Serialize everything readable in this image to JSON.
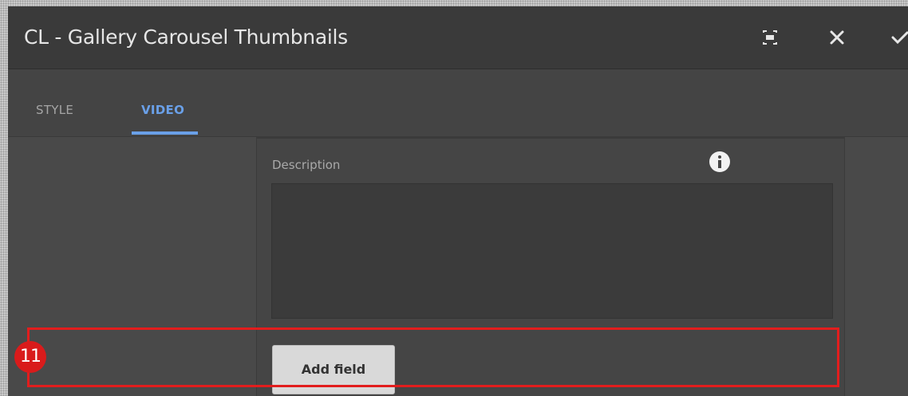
{
  "dialog": {
    "title": "CL - Gallery Carousel Thumbnails",
    "icons": {
      "fullscreen": "fullscreen-icon",
      "close": "close-icon",
      "confirm": "check-icon"
    }
  },
  "tabs": [
    {
      "label": "STYLE",
      "active": false
    },
    {
      "label": "VIDEO",
      "active": true
    }
  ],
  "form": {
    "description_label": "Description",
    "description_value": "",
    "info_icon": "info-icon",
    "add_field_label": "Add field"
  },
  "annotation": {
    "step_number": "11",
    "highlight_color": "#e21d1d"
  },
  "colors": {
    "accent": "#6aa0e8",
    "header_bg": "#3a3a3a",
    "body_bg": "#494949"
  }
}
